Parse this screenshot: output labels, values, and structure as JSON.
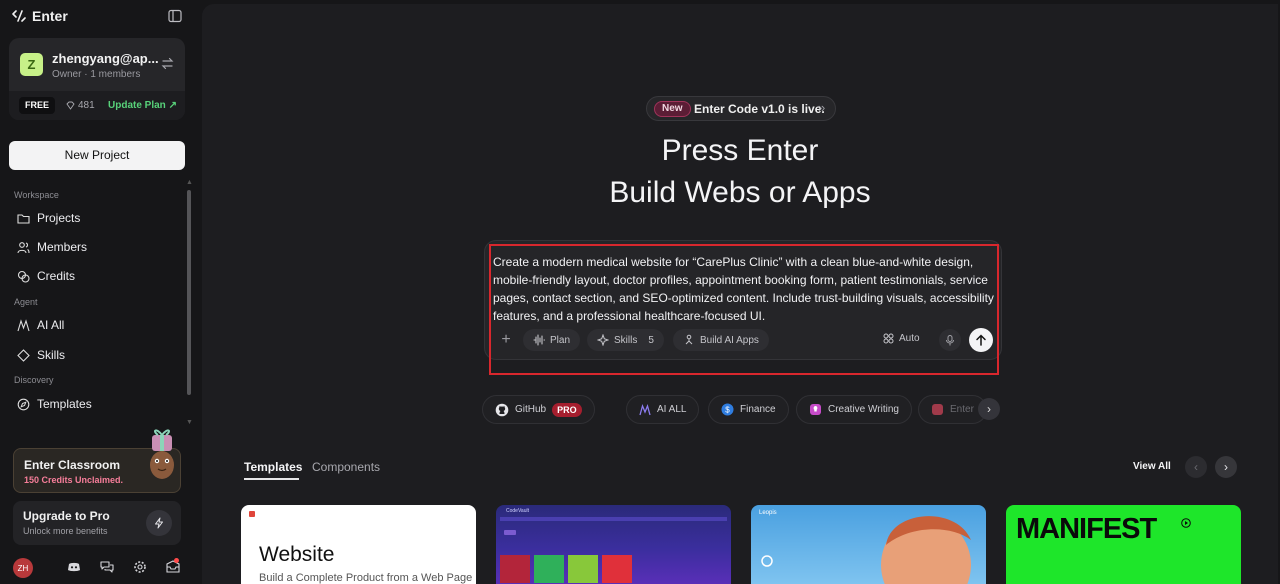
{
  "brand": {
    "name": "Enter"
  },
  "account": {
    "initial": "Z",
    "name": "zhengyang@ap...",
    "role": "Owner · 1 members",
    "plan": "FREE",
    "credits": "481",
    "update_label": "Update Plan ↗"
  },
  "sidebar": {
    "new_project": "New Project",
    "workspace_label": "Workspace",
    "agent_label": "Agent",
    "discovery_label": "Discovery",
    "items": {
      "projects": "Projects",
      "members": "Members",
      "credits": "Credits",
      "ai_all": "AI All",
      "skills": "Skills",
      "templates": "Templates"
    },
    "classroom": {
      "title": "Enter Classroom",
      "subtitle": "150 Credits Unclaimed."
    },
    "upgrade": {
      "title": "Upgrade to Pro",
      "subtitle": "Unlock more benefits"
    },
    "user_initials": "ZH"
  },
  "announcement": {
    "badge": "New",
    "text": "Enter Code v1.0 is live.",
    "arrow": "»"
  },
  "hero": {
    "line1": "Press Enter",
    "line2": "Build Webs or Apps"
  },
  "prompt": {
    "text": "Create a modern medical website for “CarePlus Clinic” with a clean blue-and-white design, mobile-friendly layout, doctor profiles, appointment booking form, patient testimonials, service pages, contact section, and SEO-optimized content. Include trust-building visuals, accessibility features, and a professional healthcare-focused UI.",
    "plus": "+",
    "plan": "Plan",
    "skills": "Skills",
    "skills_count": "5",
    "build_ai_apps": "Build AI Apps",
    "auto": "Auto"
  },
  "categories": {
    "github": "GitHub",
    "pro": "PRO",
    "ai_all": "AI ALL",
    "finance": "Finance",
    "creative_writing": "Creative Writing",
    "enter": "Enter"
  },
  "gallery": {
    "tab_templates": "Templates",
    "tab_components": "Components",
    "view_all": "View All",
    "prev": "‹",
    "next": "›",
    "card1": {
      "heading": "Website",
      "sub": "Build a Complete Product from a Web Page"
    },
    "card2": {
      "label": "CodeVault"
    },
    "card3": {
      "label": "Leopis"
    },
    "card4": {
      "label": "MANIFEST"
    }
  },
  "colors": {
    "accent_green": "#58d27a",
    "highlight_red": "#d8272d",
    "manifest_green": "#1ee62a",
    "pro_red": "#a51e2e"
  }
}
